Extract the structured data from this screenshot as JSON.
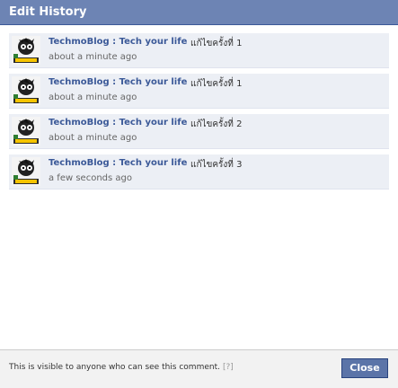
{
  "dialog": {
    "title": "Edit History"
  },
  "entries": [
    {
      "author": "TechmoBlog : Tech your life",
      "revision": "แก้ไขครั้งที่ 1",
      "time": "about a minute ago",
      "avatar_icon": "cartoon-avatar-icon"
    },
    {
      "author": "TechmoBlog : Tech your life",
      "revision": "แก้ไขครั้งที่ 1",
      "time": "about a minute ago",
      "avatar_icon": "cartoon-avatar-icon"
    },
    {
      "author": "TechmoBlog : Tech your life",
      "revision": "แก้ไขครั้งที่ 2",
      "time": "about a minute ago",
      "avatar_icon": "cartoon-avatar-icon"
    },
    {
      "author": "TechmoBlog : Tech your life",
      "revision": "แก้ไขครั้งที่ 3",
      "time": "a few seconds ago",
      "avatar_icon": "cartoon-avatar-icon"
    }
  ],
  "footer": {
    "visibility_note": "This is visible to anyone who can see this comment.",
    "help_link": "[?]",
    "close_label": "Close"
  },
  "colors": {
    "titlebar": "#6d84b4",
    "link": "#3b5998",
    "entry_bg": "#eceff5",
    "button": "#5b74a8"
  }
}
